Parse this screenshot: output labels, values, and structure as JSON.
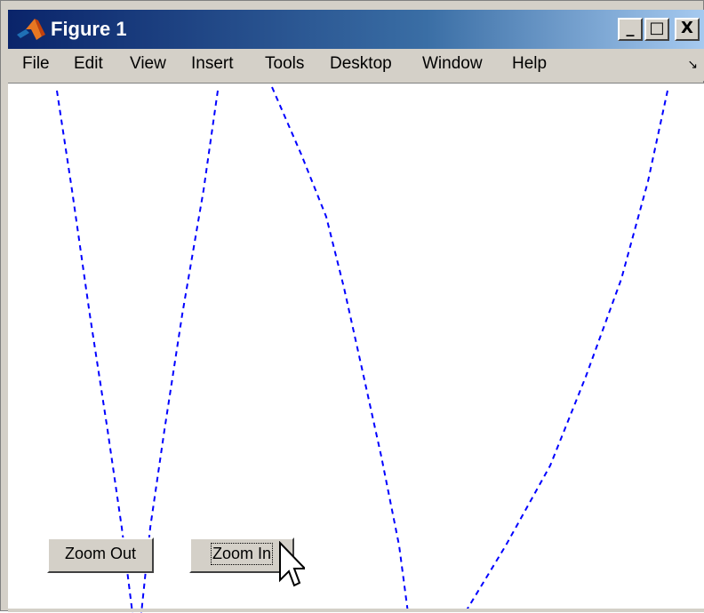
{
  "window": {
    "title": "Figure 1",
    "controls": [
      "_",
      "□",
      "X"
    ]
  },
  "menu": {
    "items": [
      "File",
      "Edit",
      "View",
      "Insert",
      "Tools",
      "Desktop",
      "Window",
      "Help"
    ],
    "dock_glyph": "↘"
  },
  "buttons": {
    "zoom_out_label": "Zoom Out",
    "zoom_in_label": "Zoom In"
  },
  "plot": {
    "line_style": "dashed",
    "line_color": "#0000ff"
  }
}
